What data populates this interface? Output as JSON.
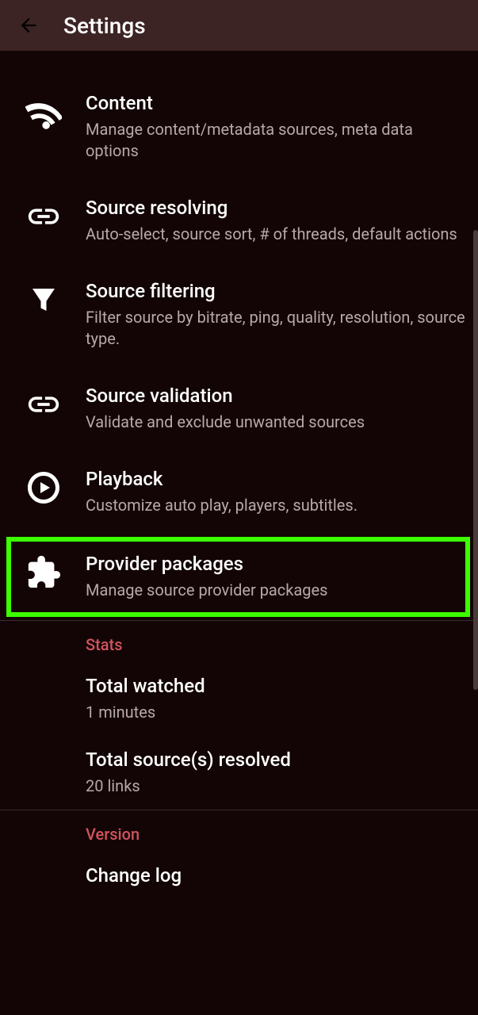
{
  "header": {
    "title": "Settings"
  },
  "items": [
    {
      "title": "Content",
      "sub": "Manage content/metadata sources, meta data options"
    },
    {
      "title": "Source resolving",
      "sub": "Auto-select, source sort, # of threads, default actions"
    },
    {
      "title": "Source filtering",
      "sub": "Filter source by bitrate, ping, quality, resolution, source type."
    },
    {
      "title": "Source validation",
      "sub": "Validate and exclude unwanted sources"
    },
    {
      "title": "Playback",
      "sub": "Customize auto play, players, subtitles."
    },
    {
      "title": "Provider packages",
      "sub": "Manage source provider packages"
    }
  ],
  "sections": {
    "stats": {
      "header": "Stats",
      "total_watched": {
        "title": "Total watched",
        "sub": "1 minutes"
      },
      "total_resolved": {
        "title": "Total source(s) resolved",
        "sub": "20 links"
      }
    },
    "version": {
      "header": "Version",
      "changelog_title": "Change log"
    }
  }
}
